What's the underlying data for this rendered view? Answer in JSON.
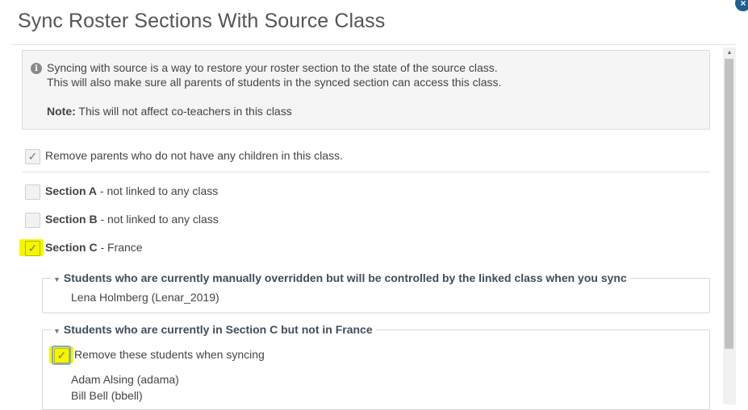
{
  "modal": {
    "title": "Sync Roster Sections With Source Class",
    "close_label": "×"
  },
  "info": {
    "line1": "Syncing with source is a way to restore your roster section to the state of the source class.",
    "line2": "This will also make sure all parents of students in the synced section can access this class.",
    "note_label": "Note:",
    "note_text": " This will not affect co-teachers in this class"
  },
  "options": {
    "remove_parents_label": "Remove parents who do not have any children in this class.",
    "remove_parents_checked": true
  },
  "sections": [
    {
      "name": "Section A",
      "detail": " - not linked to any class",
      "checked": false
    },
    {
      "name": "Section B",
      "detail": " - not linked to any class",
      "checked": false
    },
    {
      "name": "Section C",
      "detail": " - France",
      "checked": true
    }
  ],
  "groups": {
    "overridden": {
      "title": "Students who are currently manually overridden but will be controlled by the linked class when you sync",
      "students": [
        "Lena Holmberg (Lenar_2019)"
      ]
    },
    "not_in_source": {
      "title": "Students who are currently in Section C but not in France",
      "remove_label": "Remove these students when syncing",
      "remove_checked": true,
      "students": [
        "Adam Alsing (adama)",
        "Bill Bell (bbell)"
      ]
    }
  },
  "colors": {
    "highlight": "#f5f500",
    "close_button": "#1e5f8f"
  }
}
